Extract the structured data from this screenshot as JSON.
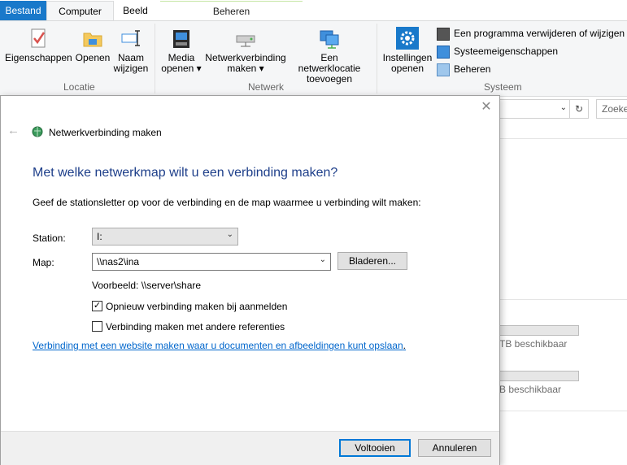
{
  "tabs": {
    "file": "Bestand",
    "computer": "Computer",
    "view": "Beeld",
    "manage": "Beheren"
  },
  "ribbon": {
    "location": {
      "label": "Locatie",
      "properties": "Eigenschappen",
      "open": "Openen",
      "rename_l1": "Naam",
      "rename_l2": "wijzigen"
    },
    "network": {
      "label": "Netwerk",
      "media_l1": "Media",
      "media_l2": "openen",
      "map_l1": "Netwerkverbinding",
      "map_l2": "maken",
      "add_l1": "Een netwerklocatie",
      "add_l2": "toevoegen"
    },
    "system": {
      "label": "Systeem",
      "settings_l1": "Instellingen",
      "settings_l2": "openen",
      "uninstall": "Een programma verwijderen of wijzigen",
      "sysprops": "Systeemeigenschappen",
      "manage": "Beheren"
    }
  },
  "explorer": {
    "search_placeholder": "Zoeke",
    "drive1_text": "TB beschikbaar",
    "drive2_text": "B beschikbaar"
  },
  "dialog": {
    "title": "Netwerkverbinding maken",
    "heading": "Met welke netwerkmap wilt u een verbinding maken?",
    "instruction": "Geef de stationsletter op voor de verbinding en de map waarmee u verbinding wilt maken:",
    "station_label": "Station:",
    "station_value": "I:",
    "map_label": "Map:",
    "map_value": "\\\\nas2\\ina",
    "browse_button": "Bladeren...",
    "example": "Voorbeeld: \\\\server\\share",
    "reconnect_label": "Opnieuw verbinding maken bij aanmelden",
    "reconnect_checked": true,
    "othercreds_label": "Verbinding maken met andere referenties",
    "othercreds_checked": false,
    "website_link": "Verbinding met een website maken waar u documenten en afbeeldingen kunt opslaan",
    "link_suffix": ".",
    "finish_button": "Voltooien",
    "cancel_button": "Annuleren"
  },
  "colors": {
    "accent": "#1979ca",
    "heading": "#1e3f8a",
    "link": "#0066cc"
  }
}
